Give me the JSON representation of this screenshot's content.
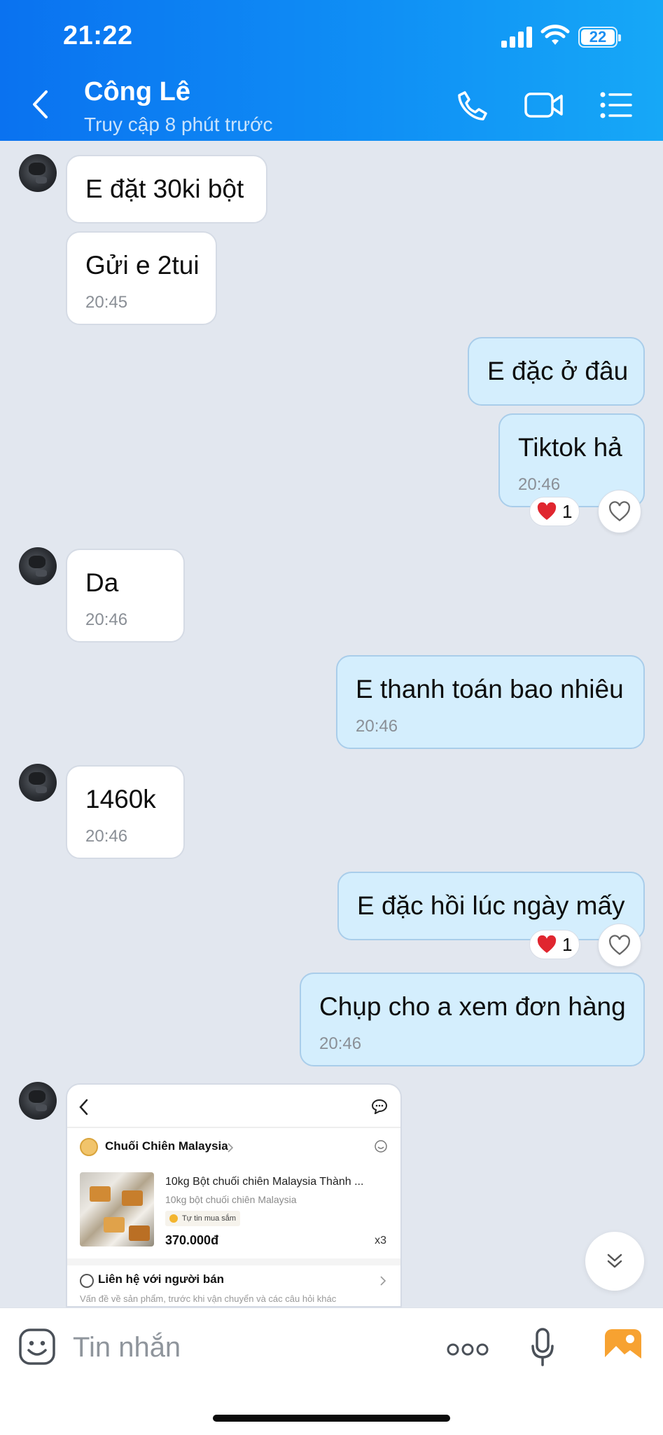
{
  "status_bar": {
    "time": "21:22",
    "battery": "22"
  },
  "header": {
    "contact_name": "Công Lê",
    "contact_status": "Truy cập 8 phút trước",
    "icons": [
      "back-icon",
      "phone-icon",
      "video-call-icon",
      "menu-icon"
    ]
  },
  "colors": {
    "header_gradient_start": "#0a72f0",
    "header_gradient_end": "#16a8f7",
    "chat_background": "#e2e7ef",
    "outgoing_bubble": "#d4eefd",
    "incoming_bubble": "#ffffff",
    "reaction_heart": "#e0262f"
  },
  "messages": [
    {
      "direction": "in",
      "text": "E đặt 30ki bột",
      "time": ""
    },
    {
      "direction": "in",
      "text": "Gửi e 2tui",
      "time": "20:45"
    },
    {
      "direction": "out",
      "text": "E đặc ở đâu",
      "time": ""
    },
    {
      "direction": "out",
      "text": "Tiktok hả",
      "time": "20:46",
      "reaction_count": "1"
    },
    {
      "direction": "in",
      "text": "Da",
      "time": "20:46"
    },
    {
      "direction": "out",
      "text": "E thanh toán bao nhiêu",
      "time": "20:46"
    },
    {
      "direction": "in",
      "text": "1460k",
      "time": "20:46"
    },
    {
      "direction": "out",
      "text": "E đặc hồi lúc ngày mấy",
      "time": "",
      "reaction_count": "1"
    },
    {
      "direction": "out",
      "text": "Chụp cho a xem đơn hàng",
      "time": "20:46"
    }
  ],
  "order_screenshot": {
    "shop_name": "Chuối Chiên Malaysia",
    "product_title": "10kg Bột chuối chiên Malaysia Thành ...",
    "product_variant": "10kg bột chuối chiên Malaysia",
    "badge": "Tự tin mua sắm",
    "price": "370.000đ",
    "quantity": "x3",
    "contact_seller": "Liên hệ với người bán",
    "contact_sub": "Vấn đề về sản phẩm, trước khi vận chuyển và các câu hỏi khác"
  },
  "input_bar": {
    "placeholder": "Tin nhắn"
  }
}
